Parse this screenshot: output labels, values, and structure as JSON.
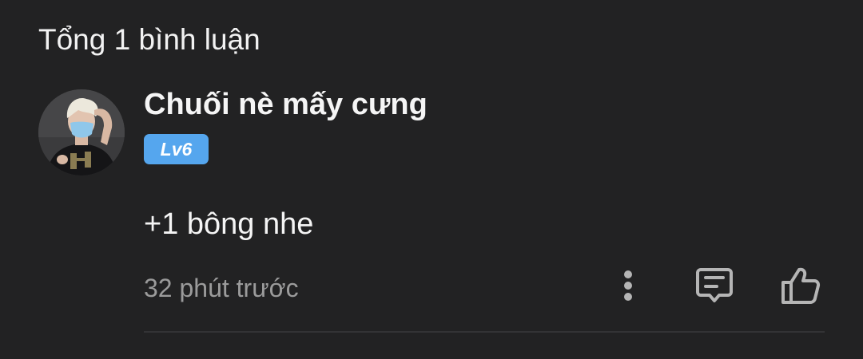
{
  "comments_header": {
    "count_label": "Tổng 1 bình luận"
  },
  "comment": {
    "username": "Chuối nè mấy cưng",
    "level_badge": "Lv6",
    "text": "+1 bông nhe",
    "timestamp": "32 phút trước",
    "actions": {
      "more_icon": "more-vertical-icon",
      "reply_icon": "reply-comment-icon",
      "like_icon": "thumbs-up-icon"
    }
  },
  "colors": {
    "background": "#222223",
    "badge": "#55a6ee",
    "secondary_text": "#9b9b9b",
    "icon": "#b5b5b5"
  }
}
